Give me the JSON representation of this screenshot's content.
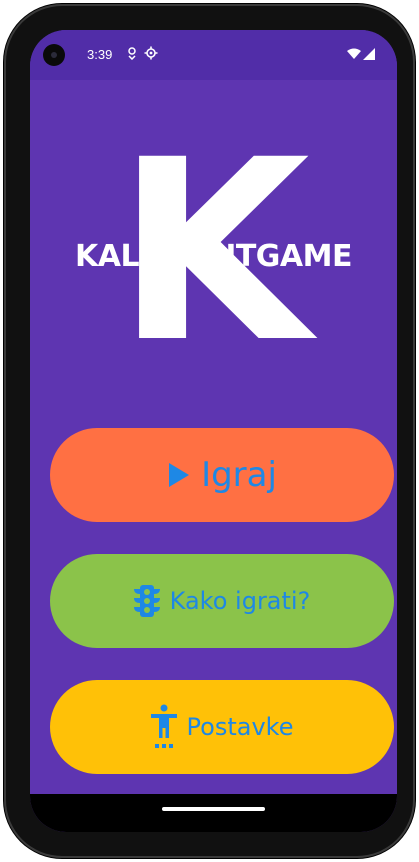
{
  "status_bar": {
    "time": "3:39",
    "left_icons": [
      "location-icon",
      "settings-icon"
    ],
    "right_icons": [
      "wifi-icon",
      "signal-icon"
    ],
    "color": "#512DA8"
  },
  "logo": {
    "letter": "K",
    "title": "KALADONTGAME"
  },
  "menu": {
    "play": {
      "label": "Igraj",
      "icon": "play-icon",
      "color": "#FF7043"
    },
    "how_to_play": {
      "label": "Kako igrati?",
      "icon": "traffic-light-icon",
      "color": "#8BC34A"
    },
    "settings": {
      "label": "Postavke",
      "icon": "accessibility-icon",
      "color": "#FFC107"
    }
  },
  "theme": {
    "background": "#5E35B1",
    "accent_text": "#1E88E5"
  }
}
